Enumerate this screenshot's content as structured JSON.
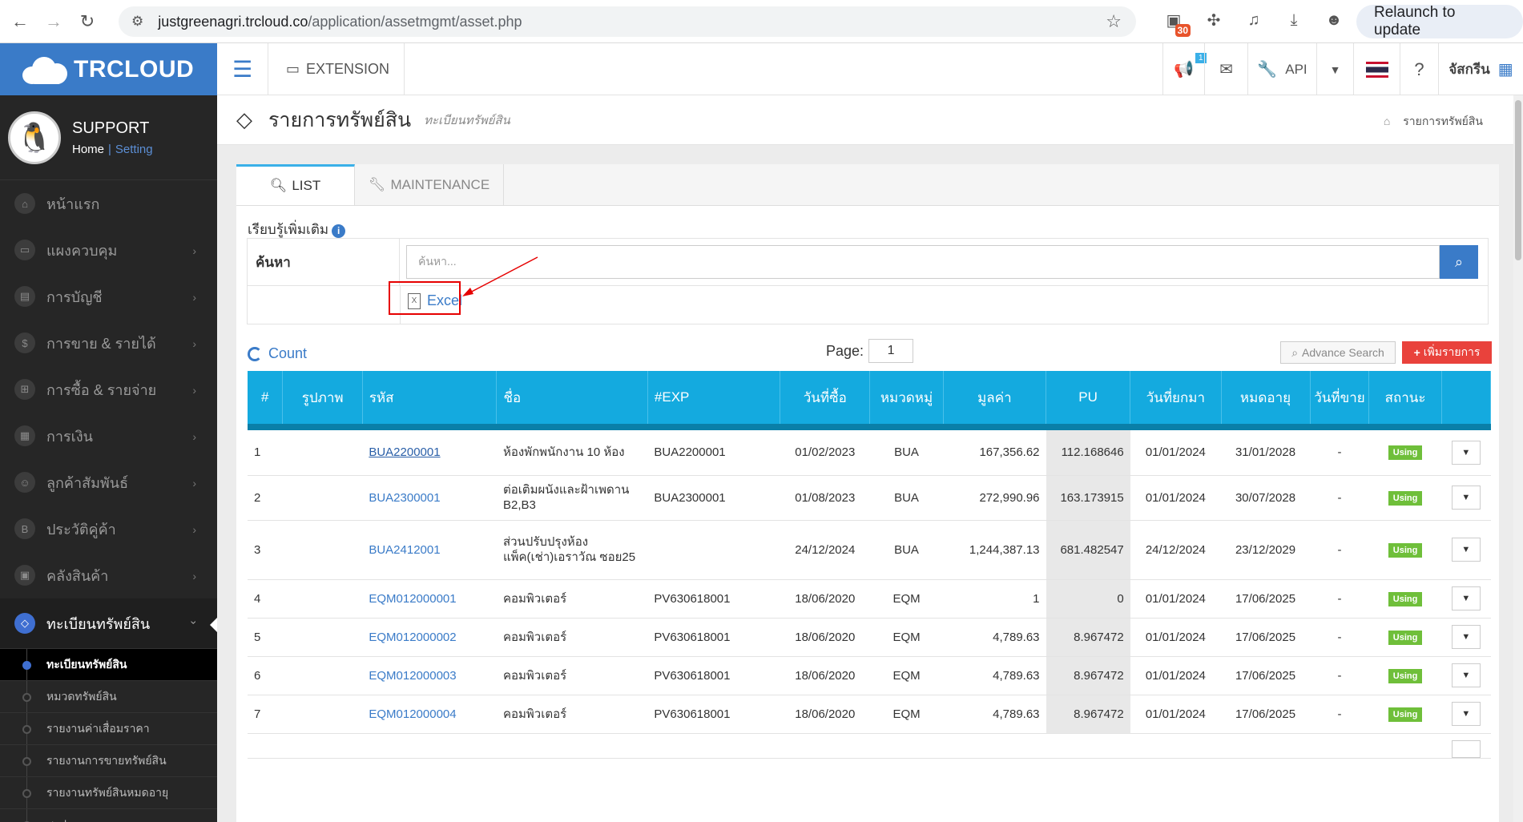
{
  "browser": {
    "url_host": "justgreenagri.trcloud.co",
    "url_path": "/application/assetmgmt/asset.php",
    "ext_badge": "30",
    "relaunch_label": "Relaunch to update"
  },
  "brand": {
    "name": "TRCLOUD"
  },
  "user": {
    "name": "SUPPORT",
    "home": "Home",
    "sep": "|",
    "setting": "Setting"
  },
  "menu": [
    {
      "label": "หน้าแรก",
      "icon": "home-icon",
      "glyph": "⌂",
      "has_children": false
    },
    {
      "label": "แผงควบคุม",
      "icon": "monitor-icon",
      "glyph": "▭",
      "has_children": true
    },
    {
      "label": "การบัญชี",
      "icon": "book-icon",
      "glyph": "▤",
      "has_children": true
    },
    {
      "label": "การขาย & รายได้",
      "icon": "dollar-icon",
      "glyph": "$",
      "has_children": true
    },
    {
      "label": "การซื้อ & รายจ่าย",
      "icon": "cart-icon",
      "glyph": "⊞",
      "has_children": true
    },
    {
      "label": "การเงิน",
      "icon": "calendar-icon",
      "glyph": "▦",
      "has_children": true
    },
    {
      "label": "ลูกค้าสัมพันธ์",
      "icon": "users-icon",
      "glyph": "☺",
      "has_children": true
    },
    {
      "label": "ประวัติคู่ค้า",
      "icon": "contact-book-icon",
      "glyph": "B",
      "has_children": true
    },
    {
      "label": "คลังสินค้า",
      "icon": "cubes-icon",
      "glyph": "▣",
      "has_children": true
    }
  ],
  "active_menu": {
    "label": "ทะเบียนทรัพย์สิน",
    "icon": "diamond-icon",
    "glyph": "◇"
  },
  "submenu": [
    {
      "label": "ทะเบียนทรัพย์สิน",
      "current": true
    },
    {
      "label": "หมวดทรัพย์สิน",
      "current": false
    },
    {
      "label": "รายงานค่าเสื่อมราคา",
      "current": false
    },
    {
      "label": "รายงานการขายทรัพย์สิน",
      "current": false
    },
    {
      "label": "รายงานทรัพย์สินหมดอายุ",
      "current": false
    },
    {
      "label": "สรุปรายการ",
      "current": false
    }
  ],
  "topbar": {
    "extension_label": "EXTENSION",
    "notification_count": "1",
    "api_label": "API",
    "company_label": "จัสกรีน"
  },
  "page": {
    "title": "รายการทรัพย์สิน",
    "subtitle": "ทะเบียนทรัพย์สิน",
    "breadcrumb": "รายการทรัพย์สิน"
  },
  "tabs": {
    "list": "LIST",
    "maintenance": "MAINTENANCE"
  },
  "learn_more": "เรียบรู้เพิ่มเติม",
  "search": {
    "label": "ค้นหา",
    "placeholder": "ค้นหา..."
  },
  "excel_label": "Excel",
  "count_label": "Count",
  "pagination": {
    "label": "Page:",
    "value": "1"
  },
  "advance_search_label": "Advance Search",
  "add_label": "เพิ่มรายการ",
  "table": {
    "headers": [
      "#",
      "รูปภาพ",
      "รหัส",
      "ชื่อ",
      "#EXP",
      "วันที่ซื้อ",
      "หมวดหมู่",
      "มูลค่า",
      "PU",
      "วันที่ยกมา",
      "หมดอายุ",
      "วันที่ขาย",
      "สถานะ",
      ""
    ],
    "rows": [
      {
        "no": "1",
        "code": "BUA2200001",
        "name": "ห้องพักพนักงาน 10 ห้อง",
        "exp": "BUA2200001",
        "buy_date": "01/02/2023",
        "category": "BUA",
        "value": "167,356.62",
        "pu": "112.168646",
        "bf_date": "01/01/2024",
        "expire": "31/01/2028",
        "sell_date": "-",
        "status": "Using"
      },
      {
        "no": "2",
        "code": "BUA2300001",
        "name": "ต่อเติมผนังและฝ้าเพดาน B2,B3",
        "exp": "BUA2300001",
        "buy_date": "01/08/2023",
        "category": "BUA",
        "value": "272,990.96",
        "pu": "163.173915",
        "bf_date": "01/01/2024",
        "expire": "30/07/2028",
        "sell_date": "-",
        "status": "Using"
      },
      {
        "no": "3",
        "code": "BUA2412001",
        "name": "ส่วนปรับปรุงห้องแพ็ค(เช่า)เอราวัณ ซอย25",
        "exp": "",
        "buy_date": "24/12/2024",
        "category": "BUA",
        "value": "1,244,387.13",
        "pu": "681.482547",
        "bf_date": "24/12/2024",
        "expire": "23/12/2029",
        "sell_date": "-",
        "status": "Using"
      },
      {
        "no": "4",
        "code": "EQM012000001",
        "name": "คอมพิวเตอร์",
        "exp": "PV630618001",
        "buy_date": "18/06/2020",
        "category": "EQM",
        "value": "1",
        "pu": "0",
        "bf_date": "01/01/2024",
        "expire": "17/06/2025",
        "sell_date": "-",
        "status": "Using"
      },
      {
        "no": "5",
        "code": "EQM012000002",
        "name": "คอมพิวเตอร์",
        "exp": "PV630618001",
        "buy_date": "18/06/2020",
        "category": "EQM",
        "value": "4,789.63",
        "pu": "8.967472",
        "bf_date": "01/01/2024",
        "expire": "17/06/2025",
        "sell_date": "-",
        "status": "Using"
      },
      {
        "no": "6",
        "code": "EQM012000003",
        "name": "คอมพิวเตอร์",
        "exp": "PV630618001",
        "buy_date": "18/06/2020",
        "category": "EQM",
        "value": "4,789.63",
        "pu": "8.967472",
        "bf_date": "01/01/2024",
        "expire": "17/06/2025",
        "sell_date": "-",
        "status": "Using"
      },
      {
        "no": "7",
        "code": "EQM012000004",
        "name": "คอมพิวเตอร์",
        "exp": "PV630618001",
        "buy_date": "18/06/2020",
        "category": "EQM",
        "value": "4,789.63",
        "pu": "8.967472",
        "bf_date": "01/01/2024",
        "expire": "17/06/2025",
        "sell_date": "-",
        "status": "Using"
      }
    ]
  },
  "colors": {
    "brand": "#3a7bc8",
    "table_header": "#14aadf",
    "status_using": "#6fbf3a",
    "add_button": "#e9423c",
    "annotation": "#e60000"
  }
}
